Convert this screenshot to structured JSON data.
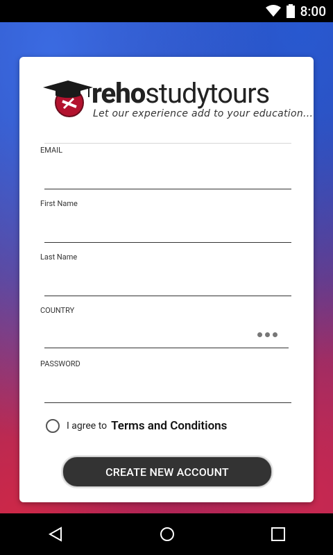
{
  "status_bar": {
    "time": "8:00"
  },
  "logo": {
    "brand_bold": "reho",
    "brand_light": "studytours",
    "tagline": "Let our experience add to your education..."
  },
  "form": {
    "email_label": "EMAIL",
    "email_value": "",
    "first_name_label": "First Name",
    "first_name_value": "",
    "last_name_label": "Last Name",
    "last_name_value": "",
    "country_label": "COUNTRY",
    "country_value": "",
    "password_label": "PASSWORD",
    "password_value": ""
  },
  "agree": {
    "text": "I agree to",
    "link": "Terms and Conditions",
    "checked": false
  },
  "create_button": {
    "label": "CREATE NEW ACCOUNT"
  },
  "colors": {
    "button_bg": "#333333",
    "card_bg": "#ffffff"
  }
}
